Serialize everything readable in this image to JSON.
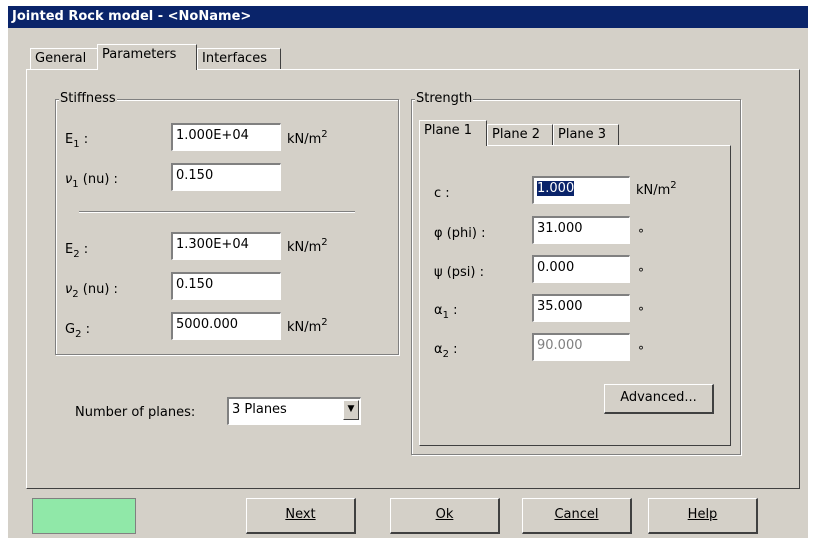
{
  "window": {
    "title": "Jointed Rock model - <NoName>"
  },
  "tabs": [
    "General",
    "Parameters",
    "Interfaces"
  ],
  "stiffness": {
    "title": "Stiffness",
    "rows": [
      {
        "sym": "E",
        "sub": "1",
        "suffix": " :",
        "value": "1.000E+04",
        "unit": "kN/m",
        "unit_sup": "2"
      },
      {
        "sym": "ν",
        "sub": "1",
        "suffix": " (nu) :",
        "value": "0.150",
        "unit": "",
        "unit_sup": ""
      },
      {
        "sym": "E",
        "sub": "2",
        "suffix": " :",
        "value": "1.300E+04",
        "unit": "kN/m",
        "unit_sup": "2"
      },
      {
        "sym": "ν",
        "sub": "2",
        "suffix": " (nu) :",
        "value": "0.150",
        "unit": "",
        "unit_sup": ""
      },
      {
        "sym": "G",
        "sub": "2",
        "suffix": " :",
        "value": "5000.000",
        "unit": "kN/m",
        "unit_sup": "2"
      }
    ]
  },
  "planes": {
    "label": "Number of planes:",
    "selected": "3 Planes"
  },
  "strength": {
    "title": "Strength",
    "tabs": [
      "Plane 1",
      "Plane 2",
      "Plane 3"
    ],
    "rows": [
      {
        "label": "c :",
        "sub": "",
        "value": "1.000",
        "unit": "kN/m",
        "unit_sup": "2"
      },
      {
        "label": "φ (phi) :",
        "sub": "",
        "value": "31.000",
        "unit": "°",
        "unit_sup": ""
      },
      {
        "label": "ψ (psi) :",
        "sub": "",
        "value": "0.000",
        "unit": "°",
        "unit_sup": ""
      },
      {
        "label": "α",
        "sub": "1",
        "value": "35.000",
        "unit": "°",
        "unit_sup": ""
      },
      {
        "label": "α",
        "sub": "2",
        "value": "90.000",
        "unit": "°",
        "unit_sup": ""
      }
    ],
    "advanced_label": "Advanced..."
  },
  "buttons": {
    "next": "Next",
    "ok": "Ok",
    "cancel": "Cancel",
    "help": "Help"
  },
  "colors": {
    "titlebar": "#0a246a",
    "indicator": "#90e8a8",
    "face": "#d4d0c8"
  }
}
